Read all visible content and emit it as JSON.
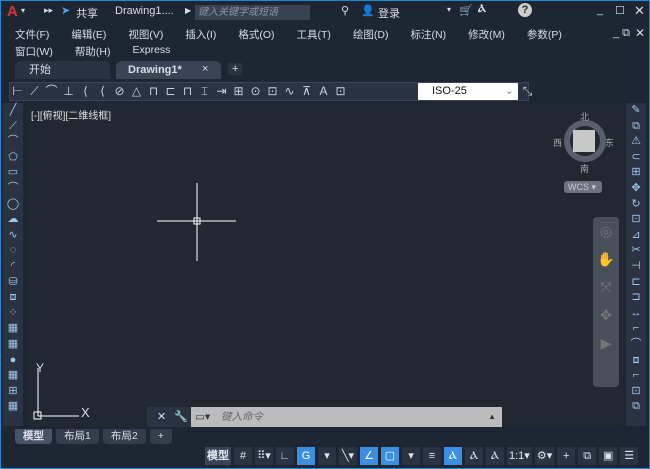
{
  "titlebar": {
    "logo": "A",
    "share": "共享",
    "doc_title": "Drawing1....",
    "search_placeholder": "键入关键字或短语",
    "login": "登录"
  },
  "menu": {
    "row1": [
      "文件(F)",
      "编辑(E)",
      "视图(V)",
      "插入(I)",
      "格式(O)",
      "工具(T)",
      "绘图(D)",
      "标注(N)",
      "修改(M)",
      "参数(P)"
    ],
    "row2": [
      "窗口(W)",
      "帮助(H)",
      "Express"
    ]
  },
  "tabs": {
    "start": "开始",
    "drawing": "Drawing1*",
    "close": "×",
    "add": "+"
  },
  "toolbar": {
    "icons": [
      "linear-dim",
      "aligned-dim",
      "arc-length-dim",
      "ordinate-dim",
      "radius-dim",
      "jogged-dim",
      "diameter-dim",
      "angular-dim",
      "quick-dim",
      "baseline-dim",
      "continue-dim",
      "dim-space",
      "dim-break",
      "tolerance",
      "center-mark",
      "inspect",
      "jogged-linear",
      "dim-edit",
      "dim-text-edit",
      "dim-update"
    ],
    "dim_style": "ISO-25"
  },
  "viewport_label": "[-][俯视][二维线框]",
  "viewcube": {
    "north": "北",
    "south": "南",
    "east": "东",
    "west": "西",
    "wcs": "WCS"
  },
  "ucs": {
    "x": "X",
    "y": "Y"
  },
  "command": {
    "placeholder": "键入命令"
  },
  "layout_tabs": [
    "模型",
    "布局1",
    "布局2",
    "+"
  ],
  "statusbar": {
    "model": "模型",
    "scale": "1:1"
  },
  "accent": "#3b8ee0"
}
